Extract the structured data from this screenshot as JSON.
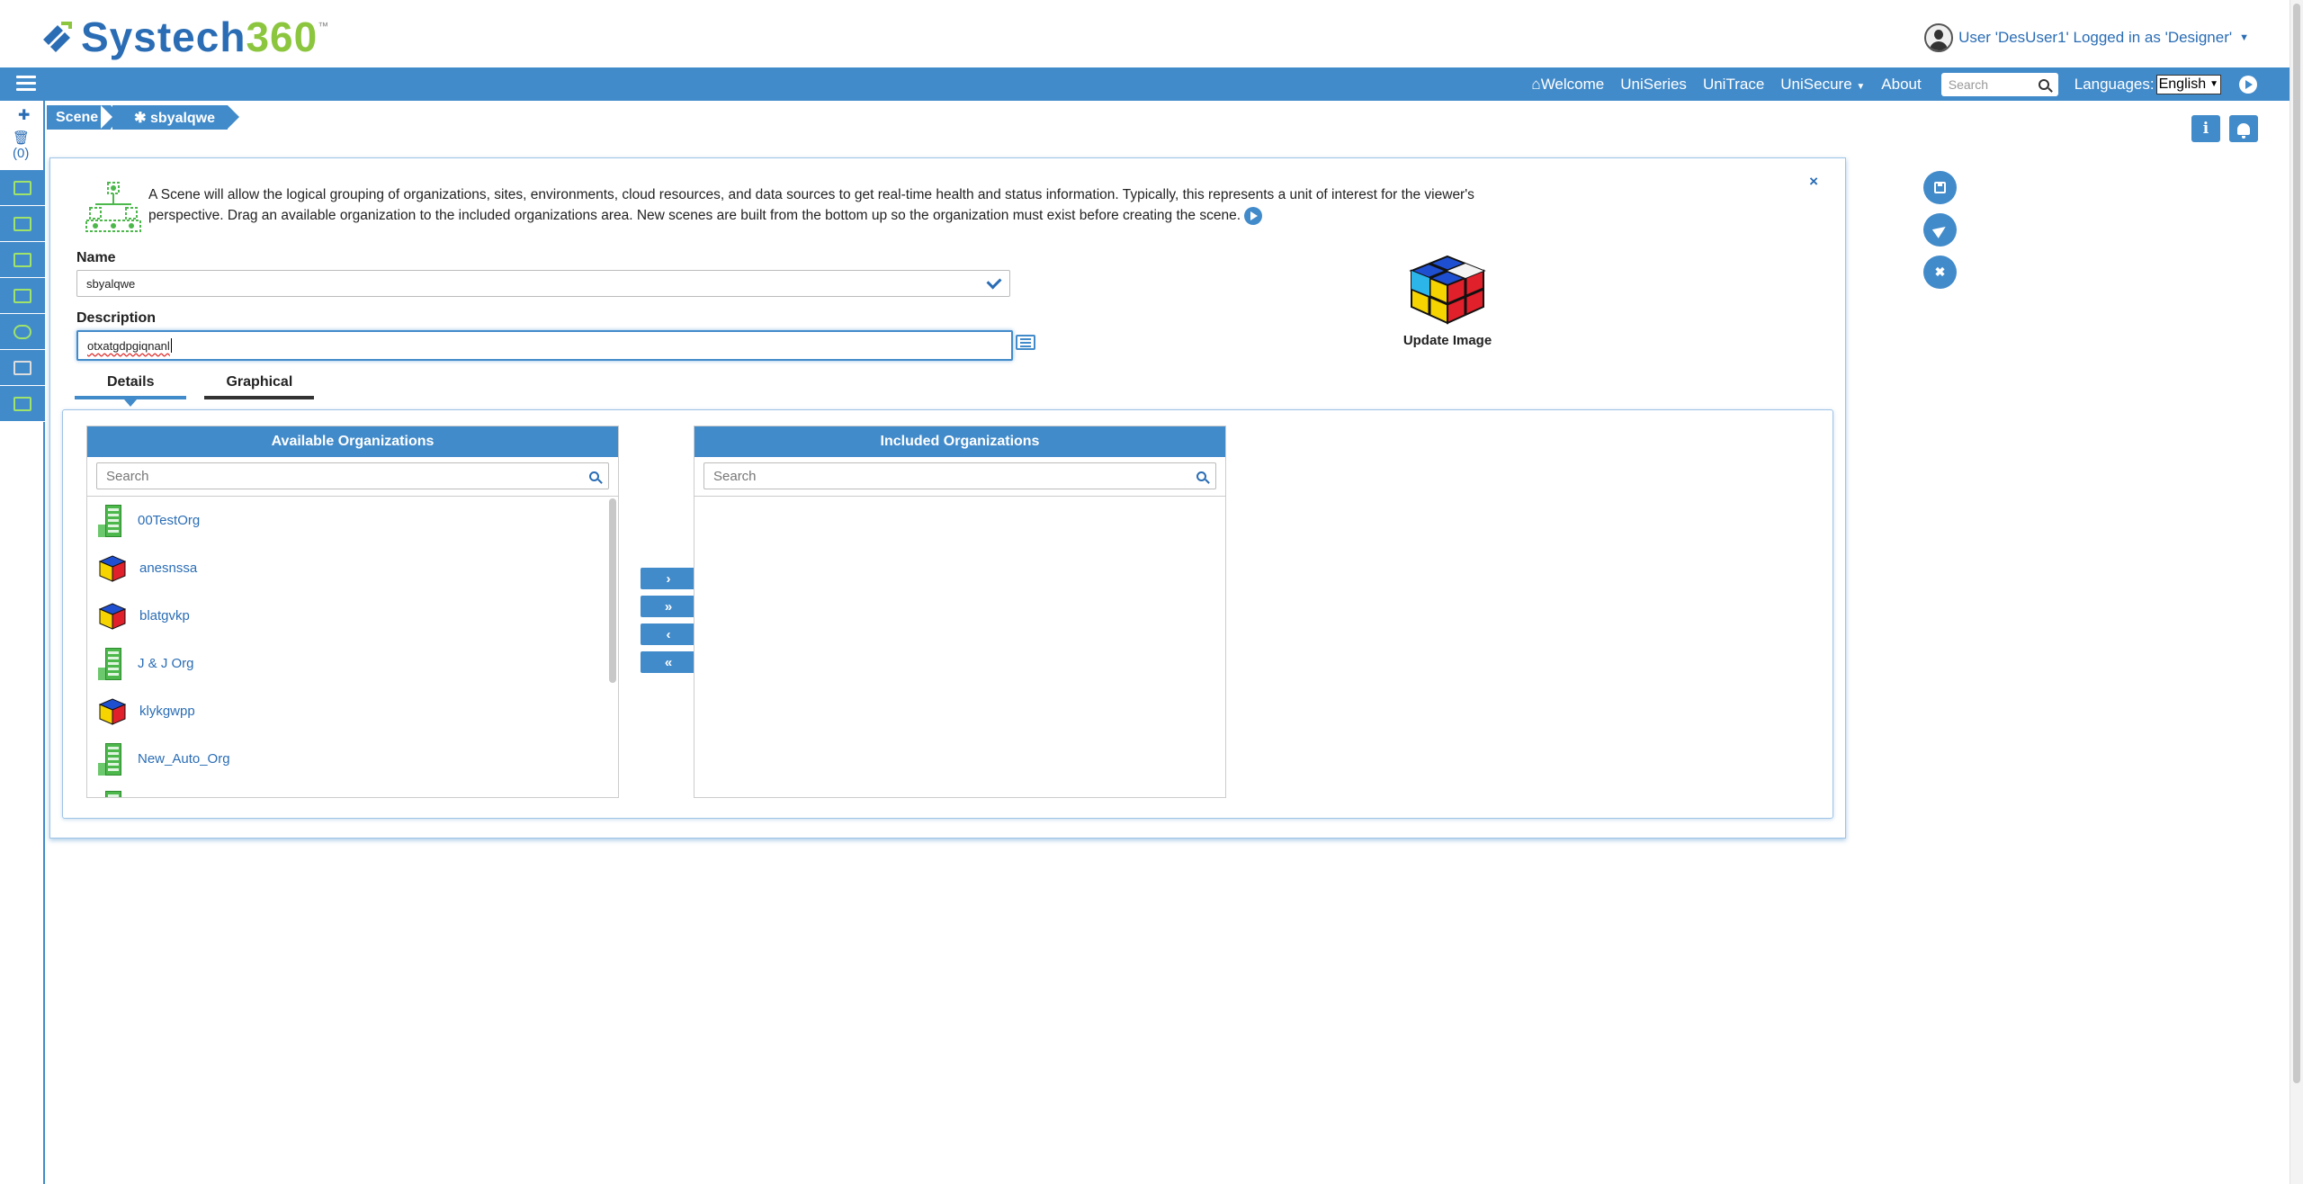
{
  "header": {
    "logo_text_a": "Systech",
    "logo_text_b": "360",
    "logo_tm": "™",
    "user_text": "User 'DesUser1' Logged in as 'Designer'"
  },
  "nav": {
    "welcome": "Welcome",
    "uniseries": "UniSeries",
    "unitrace": "UniTrace",
    "unisecure": "UniSecure",
    "about": "About",
    "search_placeholder": "Search",
    "languages_label": "Languages:",
    "language_value": "English"
  },
  "sidebar": {
    "trash_count": "(0)",
    "icons": [
      "hierarchy-icon",
      "organization-icon",
      "site-icon",
      "environment-icon",
      "cloud-icon",
      "data-source-icon",
      "devices-icon"
    ]
  },
  "breadcrumb": {
    "root": "Scene",
    "current": "✱ sbyalqwe"
  },
  "panel": {
    "info_text": "A Scene will allow the logical grouping of organizations, sites, environments, cloud resources, and data sources to get real-time health and status information. Typically, this represents a unit of interest for the viewer's perspective. Drag an available organization to the included organizations area. New scenes are built from the bottom up so the organization must exist before creating the scene.",
    "close": "×",
    "name_label": "Name",
    "name_value": "sbyalqwe",
    "description_label": "Description",
    "description_value": "otxatgdpgiqnanl",
    "update_image_label": "Update Image",
    "tabs": [
      "Details",
      "Graphical"
    ],
    "active_tab": "Details"
  },
  "available": {
    "title": "Available Organizations",
    "search_placeholder": "Search",
    "items": [
      {
        "label": "00TestOrg",
        "icon": "building-icon"
      },
      {
        "label": "anesnssa",
        "icon": "cube-icon"
      },
      {
        "label": "blatgvkp",
        "icon": "cube-icon"
      },
      {
        "label": "J & J Org",
        "icon": "building-icon"
      },
      {
        "label": "klykgwpp",
        "icon": "cube-icon"
      },
      {
        "label": "New_Auto_Org",
        "icon": "building-icon"
      }
    ]
  },
  "included": {
    "title": "Included Organizations",
    "search_placeholder": "Search"
  },
  "transfer": {
    "move_one": "›",
    "move_all": "»",
    "remove_one": "‹",
    "remove_all": "«"
  },
  "colors": {
    "primary": "#428bca",
    "link": "#2a6db5",
    "logo_blue": "#2a6db5",
    "logo_green": "#8cc63f"
  }
}
